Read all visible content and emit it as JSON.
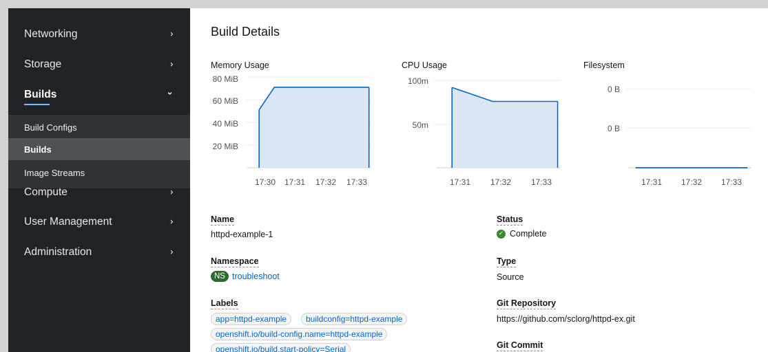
{
  "sidebar": {
    "items": [
      {
        "label": "Networking",
        "chevron": "›"
      },
      {
        "label": "Storage",
        "chevron": "›"
      },
      {
        "label": "Builds",
        "chevron": "⌄"
      },
      {
        "label": "Compute",
        "chevron": "›"
      },
      {
        "label": "User Management",
        "chevron": "›"
      },
      {
        "label": "Administration",
        "chevron": "›"
      }
    ],
    "builds_subitems": [
      {
        "label": "Build Configs"
      },
      {
        "label": "Builds"
      },
      {
        "label": "Image Streams"
      }
    ]
  },
  "page": {
    "title": "Build Details"
  },
  "charts": {
    "memory": {
      "title": "Memory Usage",
      "y_ticks": [
        "80 MiB",
        "60 MiB",
        "40 MiB",
        "20 MiB"
      ],
      "x_ticks": [
        "17:30",
        "17:31",
        "17:32",
        "17:33"
      ]
    },
    "cpu": {
      "title": "CPU Usage",
      "y_ticks": [
        "100m",
        "50m"
      ],
      "x_ticks": [
        "17:31",
        "17:32",
        "17:33"
      ]
    },
    "filesystem": {
      "title": "Filesystem",
      "y_ticks": [
        "0 B",
        "0 B"
      ],
      "x_ticks": [
        "17:31",
        "17:32",
        "17:33"
      ]
    }
  },
  "chart_data": [
    {
      "type": "area",
      "title": "Memory Usage",
      "x": [
        "17:29.8",
        "17:30.3",
        "17:33.4"
      ],
      "series": [
        {
          "values": [
            51,
            71,
            71
          ]
        }
      ],
      "ylim": [
        0,
        80
      ],
      "y_unit": "MiB",
      "grid": true,
      "color": "#06c"
    },
    {
      "type": "area",
      "title": "CPU Usage",
      "x": [
        "17:30.8",
        "17:31.8",
        "17:33.4"
      ],
      "series": [
        {
          "values": [
            92,
            76,
            76
          ]
        }
      ],
      "ylim": [
        0,
        100
      ],
      "y_unit": "m",
      "grid": true,
      "color": "#06c"
    },
    {
      "type": "area",
      "title": "Filesystem",
      "x": [
        "17:30.6",
        "17:33.4"
      ],
      "series": [
        {
          "values": [
            0,
            0
          ]
        }
      ],
      "y_unit": "B",
      "grid": true,
      "color": "#06c"
    }
  ],
  "details": {
    "name_label": "Name",
    "name_value": "httpd-example-1",
    "namespace_label": "Namespace",
    "namespace_badge": "NS",
    "namespace_value": "troubleshoot",
    "labels_label": "Labels",
    "labels": [
      "app=httpd-example",
      "buildconfig=httpd-example",
      "openshift.io/build-config.name=httpd-example",
      "openshift.io/build.start-policy=Serial"
    ],
    "status_label": "Status",
    "status_value": "Complete",
    "type_label": "Type",
    "type_value": "Source",
    "git_repo_label": "Git Repository",
    "git_repo_value": "https://github.com/sclorg/httpd-ex.git",
    "git_commit_label": "Git Commit"
  },
  "colors": {
    "sidebar_bg": "#212427",
    "subnav_bg": "#2f3236",
    "active_sub_bg": "#4f5255",
    "active_underline": "#73bcf7",
    "chart_line": "#06c",
    "chart_fill": "#dbe6f5",
    "link": "#0066cc",
    "status_ok": "#3e8635",
    "ns_badge": "#2b6b2f"
  }
}
